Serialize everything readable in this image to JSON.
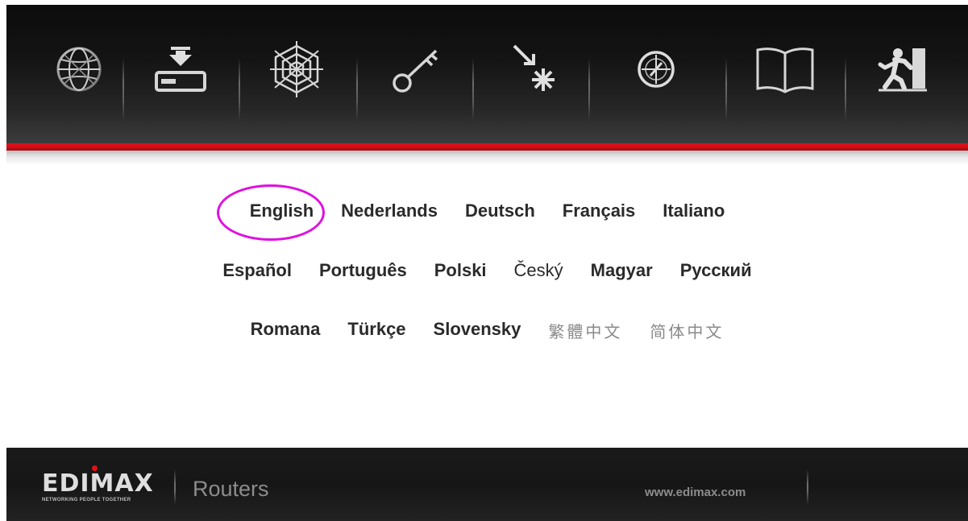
{
  "toolbar": {
    "icons": [
      {
        "name": "globe-icon"
      },
      {
        "name": "download-icon"
      },
      {
        "name": "web-icon"
      },
      {
        "name": "key-icon"
      },
      {
        "name": "spark-icon"
      },
      {
        "name": "compass-icon"
      },
      {
        "name": "book-icon"
      },
      {
        "name": "exit-icon"
      }
    ]
  },
  "languages": {
    "row1": [
      "English",
      "Nederlands",
      "Deutsch",
      "Français",
      "Italiano"
    ],
    "row2": [
      "Español",
      "Português",
      "Polski",
      "Český",
      "Magyar",
      "Pусский"
    ],
    "row3": [
      "Romana",
      "Türkçe",
      "Slovensky",
      "繁體中文",
      "简体中文"
    ],
    "highlighted": "English"
  },
  "footer": {
    "brand": "EDIMAX",
    "tagline": "NETWORKING PEOPLE TOGETHER",
    "product": "Routers",
    "website": "www.edimax.com"
  },
  "colors": {
    "accent_red": "#e3101a",
    "highlight_circle": "#e010e0",
    "topbar": "#141414"
  }
}
